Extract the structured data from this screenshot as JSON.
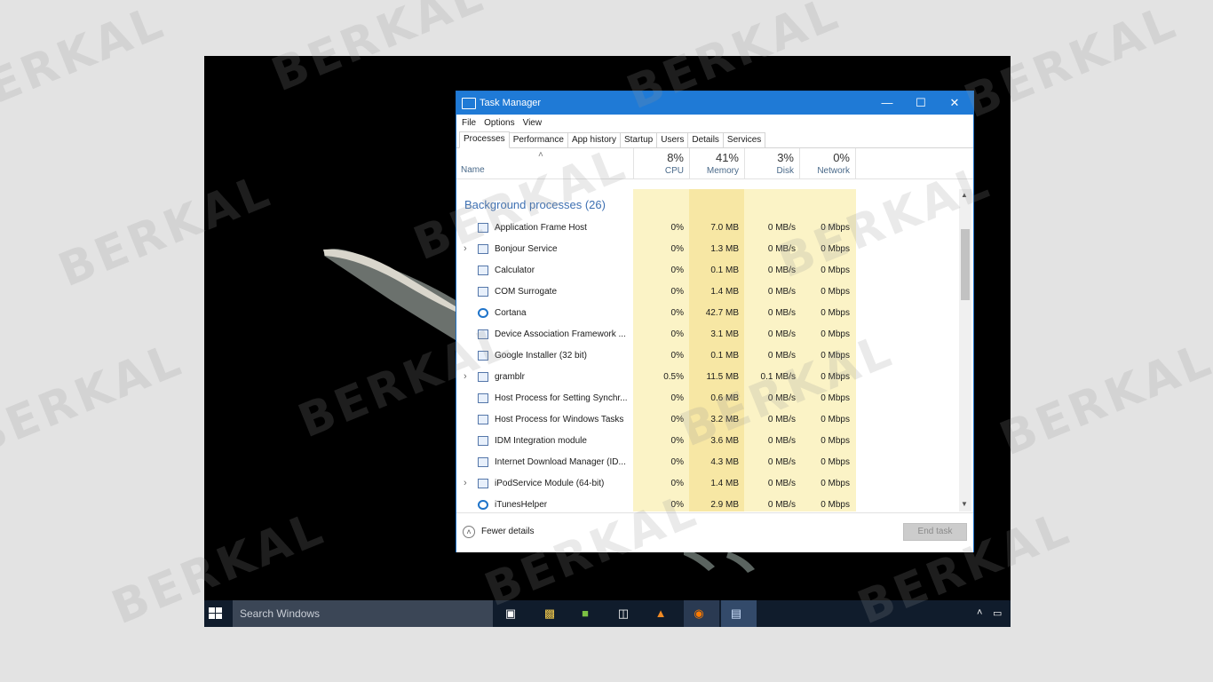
{
  "taskmanager": {
    "title": "Task Manager",
    "menu": [
      "File",
      "Options",
      "View"
    ],
    "tabs": [
      "Processes",
      "Performance",
      "App history",
      "Startup",
      "Users",
      "Details",
      "Services"
    ],
    "columns": {
      "name": "Name",
      "cpu": {
        "pct": "8%",
        "label": "CPU"
      },
      "memory": {
        "pct": "41%",
        "label": "Memory"
      },
      "disk": {
        "pct": "3%",
        "label": "Disk"
      },
      "network": {
        "pct": "0%",
        "label": "Network"
      }
    },
    "group_title": "Background processes (26)",
    "processes": [
      {
        "name": "Application Frame Host",
        "cpu": "0%",
        "mem": "7.0 MB",
        "disk": "0 MB/s",
        "net": "0 Mbps"
      },
      {
        "name": "Bonjour Service",
        "cpu": "0%",
        "mem": "1.3 MB",
        "disk": "0 MB/s",
        "net": "0 Mbps"
      },
      {
        "name": "Calculator",
        "cpu": "0%",
        "mem": "0.1 MB",
        "disk": "0 MB/s",
        "net": "0 Mbps"
      },
      {
        "name": "COM Surrogate",
        "cpu": "0%",
        "mem": "1.4 MB",
        "disk": "0 MB/s",
        "net": "0 Mbps"
      },
      {
        "name": "Cortana",
        "cpu": "0%",
        "mem": "42.7 MB",
        "disk": "0 MB/s",
        "net": "0 Mbps"
      },
      {
        "name": "Device Association Framework ...",
        "cpu": "0%",
        "mem": "3.1 MB",
        "disk": "0 MB/s",
        "net": "0 Mbps"
      },
      {
        "name": "Google Installer (32 bit)",
        "cpu": "0%",
        "mem": "0.1 MB",
        "disk": "0 MB/s",
        "net": "0 Mbps"
      },
      {
        "name": "gramblr",
        "cpu": "0.5%",
        "mem": "11.5 MB",
        "disk": "0.1 MB/s",
        "net": "0 Mbps"
      },
      {
        "name": "Host Process for Setting Synchr...",
        "cpu": "0%",
        "mem": "0.6 MB",
        "disk": "0 MB/s",
        "net": "0 Mbps"
      },
      {
        "name": "Host Process for Windows Tasks",
        "cpu": "0%",
        "mem": "3.2 MB",
        "disk": "0 MB/s",
        "net": "0 Mbps"
      },
      {
        "name": "IDM Integration module",
        "cpu": "0%",
        "mem": "3.6 MB",
        "disk": "0 MB/s",
        "net": "0 Mbps"
      },
      {
        "name": "Internet Download Manager (ID...",
        "cpu": "0%",
        "mem": "4.3 MB",
        "disk": "0 MB/s",
        "net": "0 Mbps"
      },
      {
        "name": "iPodService Module (64-bit)",
        "cpu": "0%",
        "mem": "1.4 MB",
        "disk": "0 MB/s",
        "net": "0 Mbps"
      },
      {
        "name": "iTunesHelper",
        "cpu": "0%",
        "mem": "2.9 MB",
        "disk": "0 MB/s",
        "net": "0 Mbps"
      }
    ],
    "fewer_details": "Fewer details",
    "end_task": "End task"
  },
  "taskbar": {
    "search_placeholder": "Search Windows"
  },
  "watermark": "BERKAL",
  "colors": {
    "titlebar": "#1f7ad6",
    "column_highlight": "#fbf3c6",
    "taskbar": "#101c2c"
  }
}
